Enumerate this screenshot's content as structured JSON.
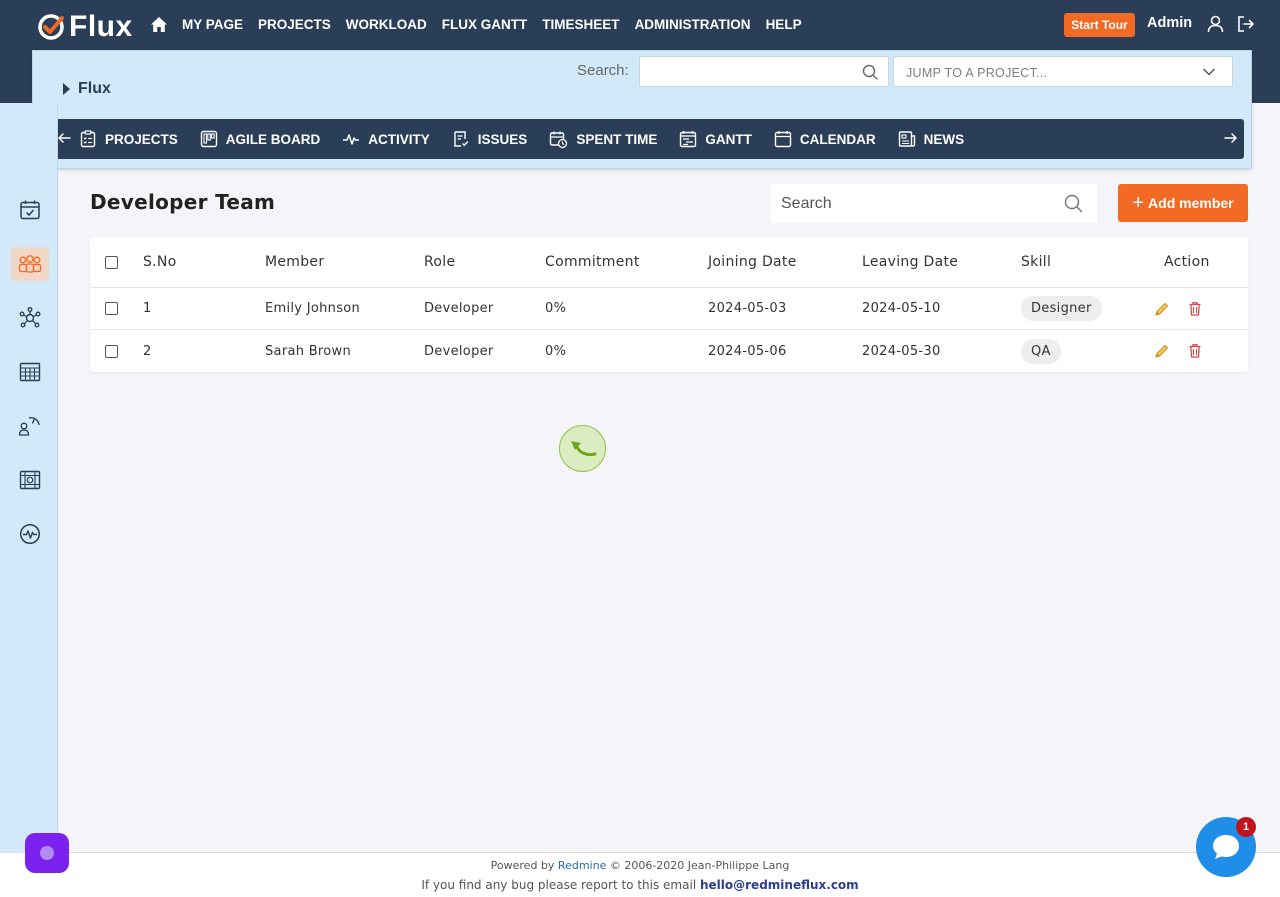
{
  "app": {
    "logo_text": "Flux",
    "top_nav": [
      "MY PAGE",
      "PROJECTS",
      "WORKLOAD",
      "FLUX GANTT",
      "TIMESHEET",
      "ADMINISTRATION",
      "HELP"
    ],
    "start_tour_label": "Start Tour",
    "user_label": "Admin"
  },
  "project_bar": {
    "project_name": "Flux",
    "search_label": "Search:",
    "search_value": "",
    "jump_placeholder": "JUMP TO A PROJECT...",
    "menu": [
      {
        "label": "PROJECTS",
        "icon": "clipboard-icon"
      },
      {
        "label": "AGILE BOARD",
        "icon": "kanban-icon"
      },
      {
        "label": "ACTIVITY",
        "icon": "pulse-icon"
      },
      {
        "label": "ISSUES",
        "icon": "issues-icon"
      },
      {
        "label": "SPENT TIME",
        "icon": "calendar-clock-icon"
      },
      {
        "label": "GANTT",
        "icon": "gantt-icon"
      },
      {
        "label": "CALENDAR",
        "icon": "calendar-icon"
      },
      {
        "label": "NEWS",
        "icon": "news-icon"
      }
    ]
  },
  "sidebar": {
    "icons": [
      "calendar-check-icon",
      "team-icon",
      "network-icon",
      "grid-table-icon",
      "dashboard-user-icon",
      "resource-grid-icon",
      "activity-circle-icon"
    ],
    "active_index": 1
  },
  "main": {
    "title": "Developer Team",
    "search_placeholder": "Search",
    "add_member_label": "Add member",
    "add_member_plus": "+",
    "table": {
      "headers": [
        "S.No",
        "Member",
        "Role",
        "Commitment",
        "Joining Date",
        "Leaving Date",
        "Skill",
        "Action"
      ],
      "rows": [
        {
          "sno": "1",
          "member": "Emily Johnson",
          "role": "Developer",
          "commitment": "0%",
          "joining": "2024-05-03",
          "leaving": "2024-05-10",
          "skill": "Designer"
        },
        {
          "sno": "2",
          "member": "Sarah Brown",
          "role": "Developer",
          "commitment": "0%",
          "joining": "2024-05-06",
          "leaving": "2024-05-30",
          "skill": "QA"
        }
      ]
    }
  },
  "footer": {
    "powered_prefix": "Powered by",
    "powered_link": "Redmine",
    "powered_suffix": "© 2006-2020 Jean-Philippe Lang",
    "bug_text": "If you find any bug please report to this email",
    "email": "hello@redmineflux.com"
  },
  "chat": {
    "badge_count": "1"
  },
  "colors": {
    "navbar": "#2a3f57",
    "accent": "#f26a23",
    "panel": "#d1e9f8",
    "chat": "#1e8ee8",
    "badge": "#c0131f",
    "purple": "#7b22f0"
  }
}
